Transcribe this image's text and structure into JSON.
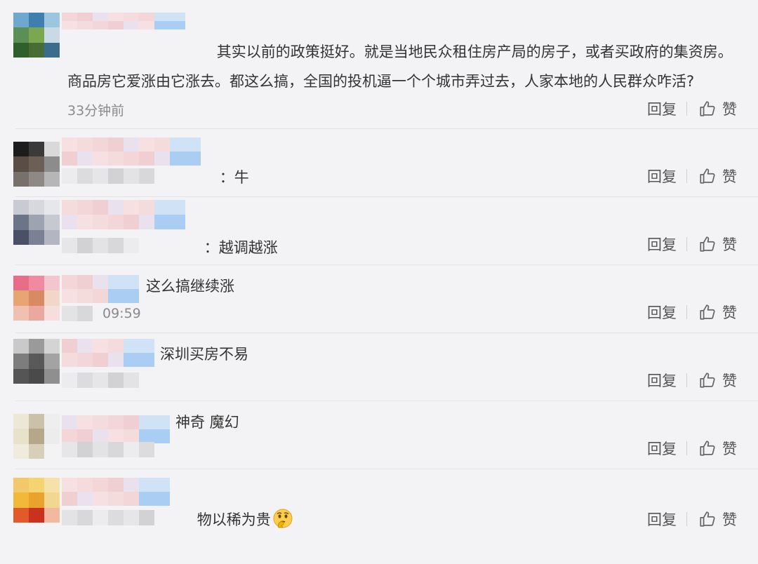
{
  "actions": {
    "reply_label": "回复",
    "like_label": "赞"
  },
  "comments": [
    {
      "text": "其实以前的政策挺好。就是当地民众租住房产局的房子，或者买政府的集资房。商品房它爱涨由它涨去。都这么搞，全国的投机逼一个个城市弄过去，人家本地的人民群众咋活?",
      "time": "33分钟前",
      "avatar_colors": [
        "#6ea8cf",
        "#3f7fb0",
        "#9cc6e0",
        "#5a8f55",
        "#7aa84f",
        "#c9d9e6",
        "#2f5f2a",
        "#486c35",
        "#3b6c8c"
      ]
    },
    {
      "text": "牛",
      "time": "",
      "avatar_colors": [
        "#1c1c1c",
        "#3a3a3a",
        "#d9d9d9",
        "#5a4d45",
        "#6b5f56",
        "#8c8c8c",
        "#77706b",
        "#8e8984",
        "#b6b6b6"
      ]
    },
    {
      "text": "越调越涨",
      "time": "",
      "avatar_colors": [
        "#c9cbd3",
        "#d6d8de",
        "#e6e7eb",
        "#6c7488",
        "#9ea3b0",
        "#c7c9d1",
        "#4a5066",
        "#7b8194",
        "#b3b6c0"
      ]
    },
    {
      "text": "这么搞继续涨",
      "time": "09:59",
      "avatar_colors": [
        "#e86e88",
        "#f08aa0",
        "#f3c5cf",
        "#e8a574",
        "#d88b62",
        "#f2d7c8",
        "#f0c0b0",
        "#e9a9a0",
        "#f5dedb"
      ]
    },
    {
      "text": "深圳买房不易",
      "time": "",
      "avatar_colors": [
        "#c9c9c9",
        "#9a9a9a",
        "#d4d4d4",
        "#7d7d7d",
        "#595959",
        "#a3a3a3",
        "#555555",
        "#4a4a4a",
        "#8f8f8f"
      ]
    },
    {
      "text": "神奇 魔幻",
      "time": "",
      "avatar_colors": [
        "#ece7d6",
        "#cbc0a8",
        "#eeeeee",
        "#e8e2c8",
        "#b5a88a",
        "#ececec",
        "#f0ecdd",
        "#d7cfb8",
        "#f3f3f3"
      ]
    },
    {
      "text": "物以稀为贵",
      "time": "",
      "avatar_colors": [
        "#f3c86a",
        "#f5d36e",
        "#f6e2a8",
        "#f2b83a",
        "#e9a32c",
        "#f3d690",
        "#e05a2a",
        "#c8321e",
        "#f1b9a0"
      ]
    }
  ]
}
